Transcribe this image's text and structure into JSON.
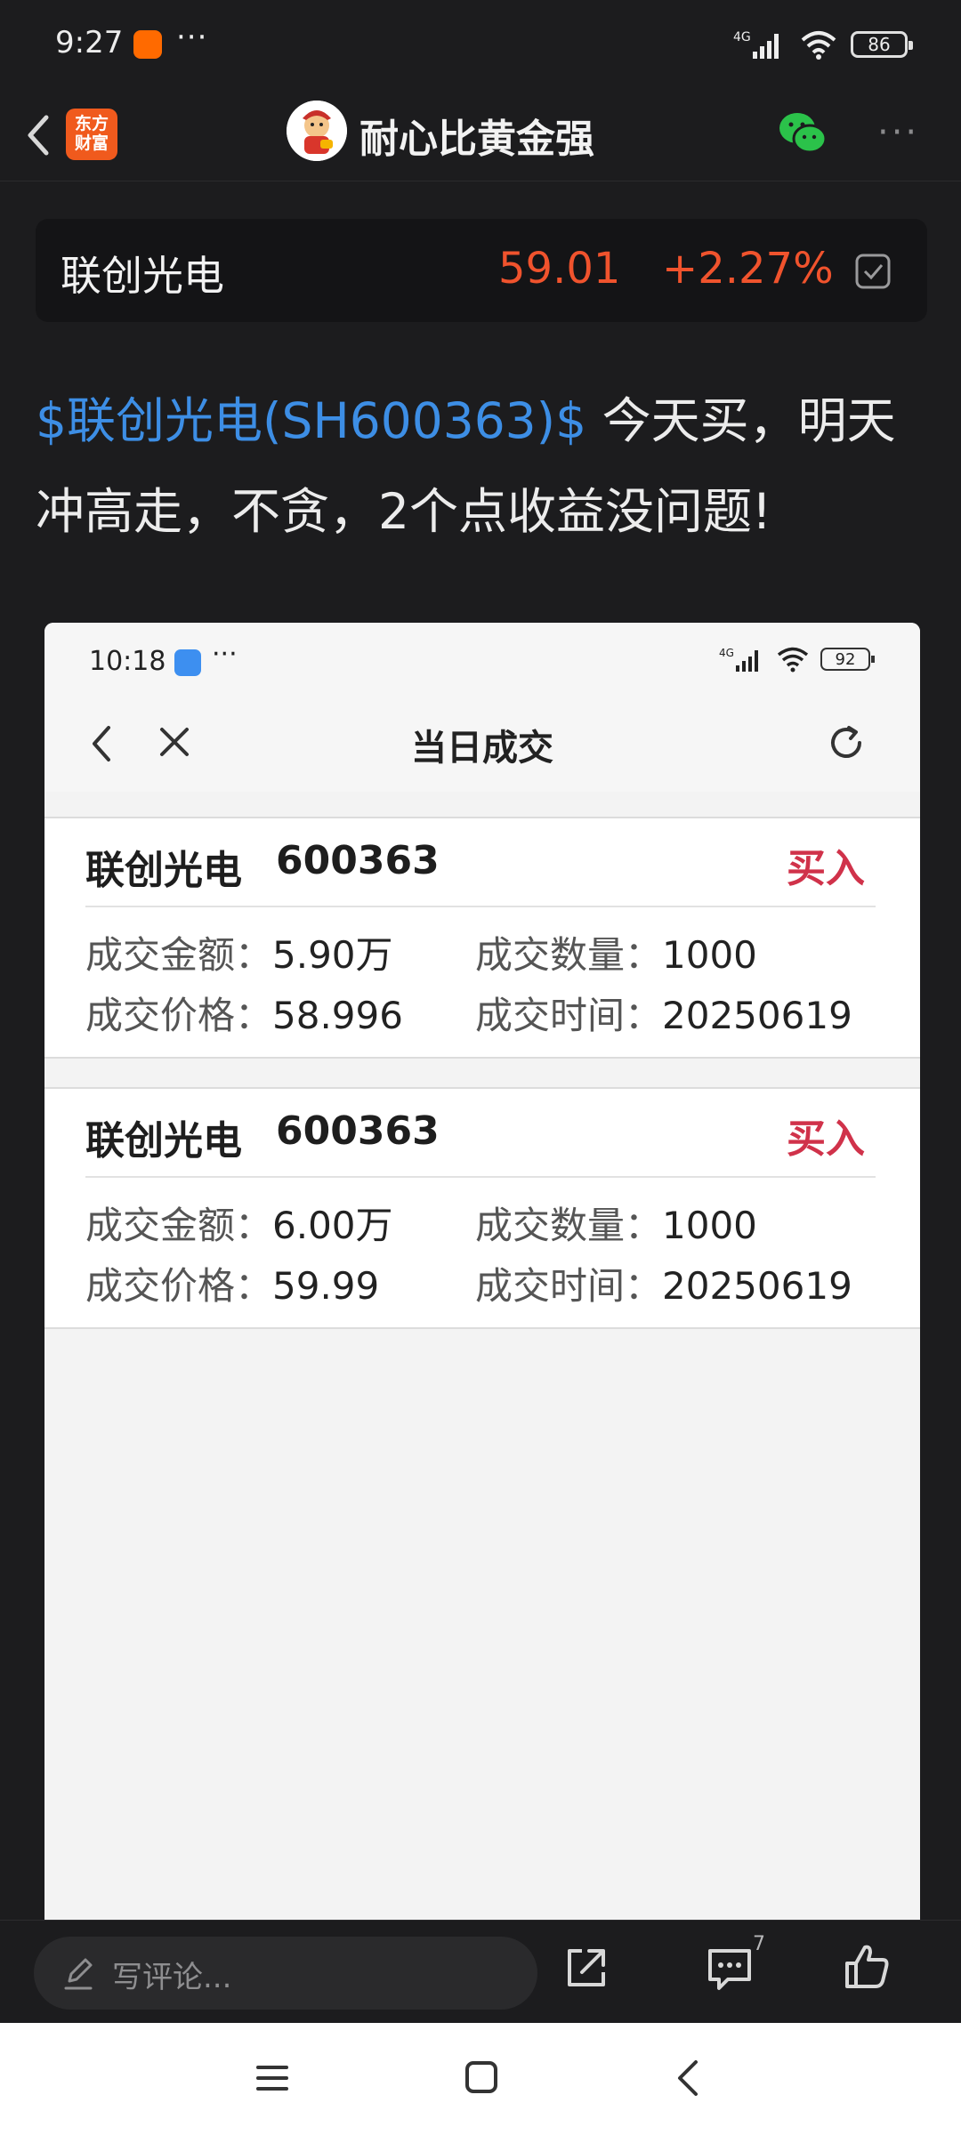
{
  "status_bar": {
    "time": "9:27",
    "battery": "86",
    "network": "4G",
    "more_glyph": "···"
  },
  "header": {
    "app_logo_text_line1": "东方",
    "app_logo_text_line2": "财富",
    "title": "耐心比黄金强"
  },
  "stock": {
    "name": "联创光电",
    "price": "59.01",
    "change": "+2.27%",
    "color_up": "#f0532d"
  },
  "post": {
    "tag": "$联创光电(SH600363)$",
    "text": " 今天买，明天冲高走，不贪，2个点收益没问题!"
  },
  "screenshot": {
    "status_time": "10:18",
    "status_battery": "92",
    "status_network": "4G",
    "more_glyph": "···",
    "nav_title": "当日成交",
    "trades": [
      {
        "name": "联创光电",
        "code": "600363",
        "action": "买入",
        "amount_label": "成交金额：",
        "amount": "5.90万",
        "qty_label": "成交数量：",
        "qty": "1000",
        "price_label": "成交价格：",
        "price": "58.996",
        "time_label": "成交时间：",
        "time": "20250619"
      },
      {
        "name": "联创光电",
        "code": "600363",
        "action": "买入",
        "amount_label": "成交金额：",
        "amount": "6.00万",
        "qty_label": "成交数量：",
        "qty": "1000",
        "price_label": "成交价格：",
        "price": "59.99",
        "time_label": "成交时间：",
        "time": "20250619"
      }
    ]
  },
  "bottom_bar": {
    "comment_placeholder": "写评论...",
    "comment_count": "7"
  }
}
